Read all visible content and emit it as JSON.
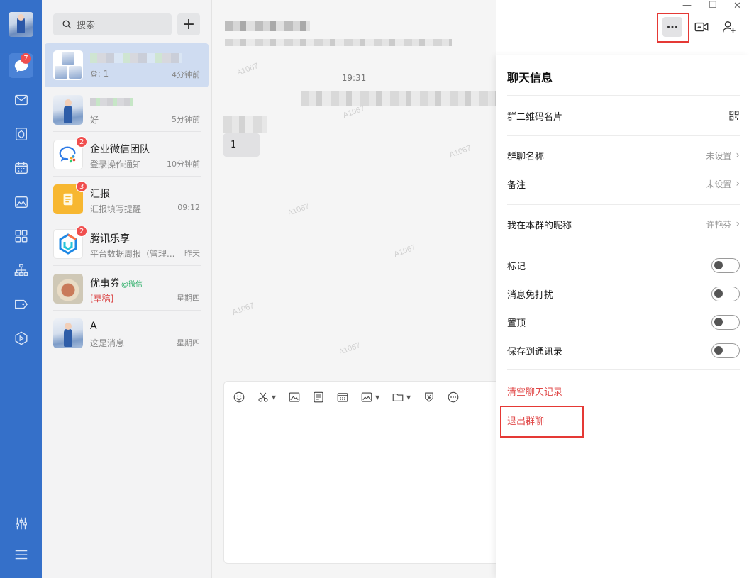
{
  "nav": {
    "chat_badge": "7"
  },
  "search": {
    "placeholder": "搜索",
    "add_label": "+"
  },
  "conversations": [
    {
      "name": "",
      "sub": "⚙: 1",
      "time": "4分钟前"
    },
    {
      "name": "",
      "sub": "好",
      "time": "5分钟前"
    },
    {
      "name": "企业微信团队",
      "sub": "登录操作通知",
      "time": "10分钟前",
      "badge": "2"
    },
    {
      "name": "汇报",
      "sub": "汇报填写提醒",
      "time": "09:12",
      "badge": "3"
    },
    {
      "name": "腾讯乐享",
      "sub": "平台数据周报（管理...",
      "time": "昨天",
      "badge": "2"
    },
    {
      "name": "优事券",
      "tag": "@微信",
      "draft": "[草稿]",
      "time": "星期四"
    },
    {
      "name": "A",
      "sub": "这是消息",
      "time": "星期四"
    }
  ],
  "chat": {
    "timestamp": "19:31",
    "bubble_text": "1",
    "watermark": "A1067"
  },
  "panel": {
    "title": "聊天信息",
    "qr_label": "群二维码名片",
    "group_name_label": "群聊名称",
    "group_name_value": "未设置",
    "remark_label": "备注",
    "remark_value": "未设置",
    "nickname_label": "我在本群的昵称",
    "nickname_value": "许艳芬",
    "mark_label": "标记",
    "mute_label": "消息免打扰",
    "pin_label": "置顶",
    "save_label": "保存到通讯录",
    "clear_label": "清空聊天记录",
    "exit_label": "退出群聊"
  },
  "window": {
    "minimize": "—",
    "maximize": "☐",
    "close": "✕"
  }
}
